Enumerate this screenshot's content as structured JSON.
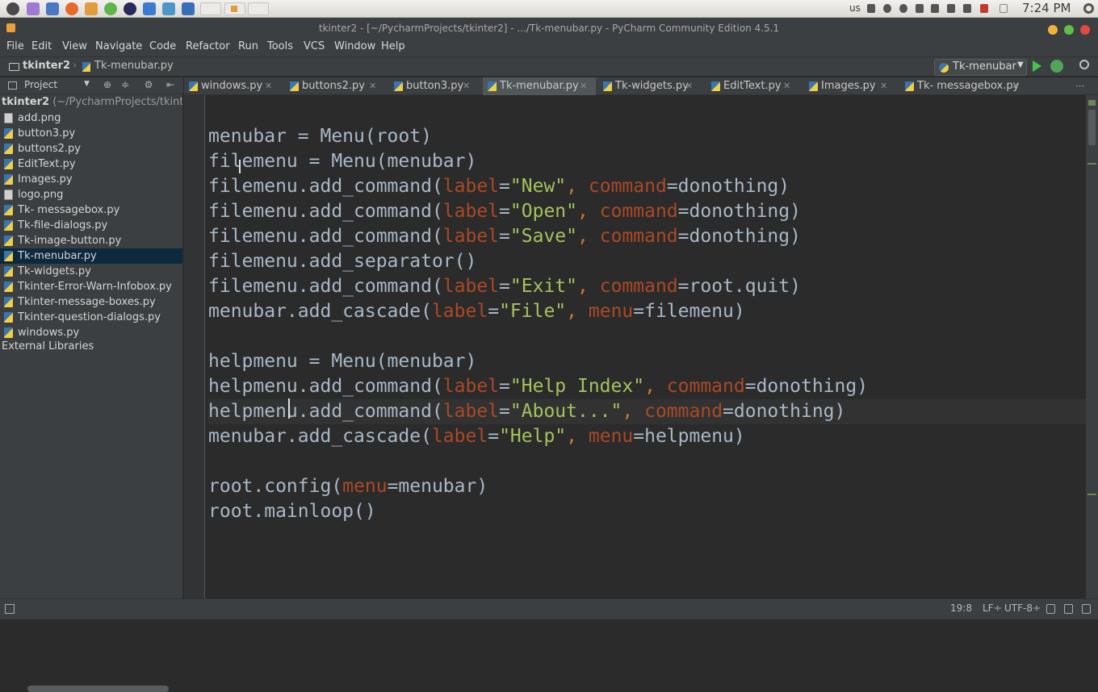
{
  "os_panel": {
    "keyboard_layout": "us",
    "clock": "7:24 PM",
    "launcher_icons": [
      "system-icon",
      "ubuntu-icon",
      "app-icon",
      "firefox-icon",
      "app-icon",
      "chrome-icon",
      "app-icon",
      "app-icon",
      "app-icon",
      "app-icon"
    ]
  },
  "window": {
    "title": "tkinter2 - [~/PycharmProjects/tkinter2] - .../Tk-menubar.py - PyCharm Community Edition 4.5.1"
  },
  "menubar": {
    "items": [
      "File",
      "Edit",
      "View",
      "Navigate",
      "Code",
      "Refactor",
      "Run",
      "Tools",
      "VCS",
      "Window",
      "Help"
    ]
  },
  "navbar": {
    "project": "tkinter2",
    "separator": "›",
    "file": "Tk-menubar.py",
    "run_config": "Tk-menubar"
  },
  "project_panel": {
    "label": "Project",
    "root_name": "tkinter2",
    "root_path": "(~/PycharmProjects/tkinter2)",
    "files": [
      {
        "name": "add.png",
        "type": "png"
      },
      {
        "name": "button3.py",
        "type": "py"
      },
      {
        "name": "buttons2.py",
        "type": "py"
      },
      {
        "name": "EditText.py",
        "type": "py"
      },
      {
        "name": "Images.py",
        "type": "py"
      },
      {
        "name": "logo.png",
        "type": "png"
      },
      {
        "name": "Tk- messagebox.py",
        "type": "py"
      },
      {
        "name": "Tk-file-dialogs.py",
        "type": "py"
      },
      {
        "name": "Tk-image-button.py",
        "type": "py"
      },
      {
        "name": "Tk-menubar.py",
        "type": "py",
        "selected": true
      },
      {
        "name": "Tk-widgets.py",
        "type": "py"
      },
      {
        "name": "Tkinter-Error-Warn-Infobox.py",
        "type": "py"
      },
      {
        "name": "Tkinter-message-boxes.py",
        "type": "py"
      },
      {
        "name": "Tkinter-question-dialogs.py",
        "type": "py"
      },
      {
        "name": "windows.py",
        "type": "py"
      }
    ],
    "external": "External Libraries"
  },
  "tabs": [
    {
      "label": "windows.py",
      "active": false
    },
    {
      "label": "buttons2.py",
      "active": false
    },
    {
      "label": "button3.py",
      "active": false
    },
    {
      "label": "Tk-menubar.py",
      "active": true
    },
    {
      "label": "Tk-widgets.py",
      "active": false
    },
    {
      "label": "EditText.py",
      "active": false
    },
    {
      "label": "Images.py",
      "active": false
    },
    {
      "label": "Tk- messagebox.py",
      "active": false
    }
  ],
  "code_lines": [
    "menubar = Menu(root)",
    "filemenu = Menu(menubar)",
    "filemenu.add_command(label=\"New\", command=donothing)",
    "filemenu.add_command(label=\"Open\", command=donothing)",
    "filemenu.add_command(label=\"Save\", command=donothing)",
    "filemenu.add_separator()",
    "filemenu.add_command(label=\"Exit\", command=root.quit)",
    "menubar.add_cascade(label=\"File\", menu=filemenu)",
    "",
    "helpmenu = Menu(menubar)",
    "helpmenu.add_command(label=\"Help Index\", command=donothing)",
    "helpmenu.add_command(label=\"About...\", command=donothing)",
    "menubar.add_cascade(label=\"Help\", menu=helpmenu)",
    "",
    "root.config(menu=menubar)",
    "root.mainloop()"
  ],
  "current_line_index": 11,
  "status": {
    "position": "19:8",
    "line_ending": "LF÷",
    "encoding": "UTF-8÷"
  },
  "colors": {
    "background": "#2b2b2b",
    "panel": "#3c3f41",
    "keyword": "#cc7832",
    "string": "#a5c25c",
    "parameter": "#aa4926",
    "text": "#a9b7c6",
    "selection": "#0d293e"
  }
}
